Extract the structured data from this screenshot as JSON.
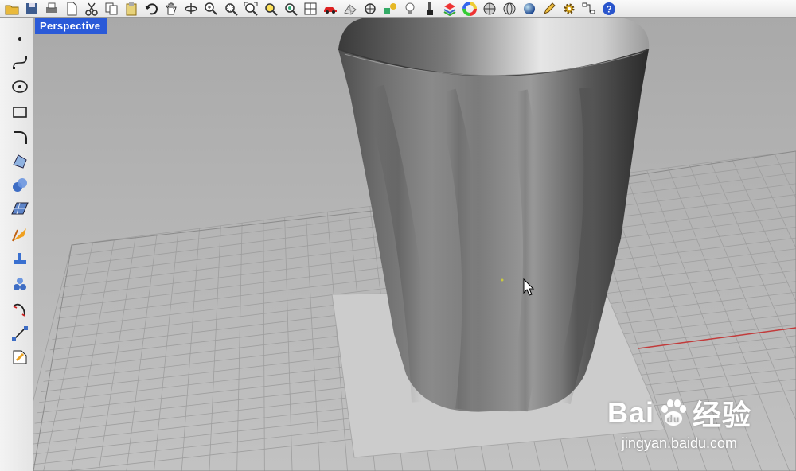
{
  "viewport": {
    "label": "Perspective"
  },
  "toolbar": {
    "icons": [
      "open-file-icon",
      "save-icon",
      "print-icon",
      "new-file-icon",
      "cut-icon",
      "copy-icon",
      "paste-icon",
      "undo-icon",
      "pan-hand-icon",
      "rotate-view-icon",
      "zoom-dynamic-icon",
      "zoom-window-icon",
      "zoom-extents-icon",
      "zoom-selected-icon",
      "zoom-target-icon",
      "four-viewports-icon",
      "car-render-icon",
      "grid-snap-icon",
      "point-on-icon",
      "object-properties-icon",
      "lightbulb-icon",
      "paintbrush-icon",
      "layers-icon",
      "color-wheel-icon",
      "shaded-sphere-icon",
      "render-sphere-icon",
      "blue-sphere-icon",
      "pencil-options-icon",
      "gear-icon",
      "history-icon",
      "help-icon"
    ]
  },
  "left_toolbar": {
    "icons": [
      "point-icon",
      "curve-icon",
      "circle-icon",
      "rectangle-icon",
      "fillet-curve-icon",
      "surface-icon",
      "solid-spheres-icon",
      "mesh-plane-icon",
      "transform-icon",
      "boolean-icon",
      "group-spheres-icon",
      "curve-from-object-icon",
      "dimension-icon",
      "analyze-icon"
    ]
  },
  "watermark": {
    "logo": "Bai du 经验",
    "logo_left": "Bai",
    "logo_right": "经验",
    "url": "jingyan.baidu.com"
  },
  "colors": {
    "viewport_label_bg": "#2a5ad8",
    "x_axis": "#c23b3b",
    "background": "#b4b4b4"
  }
}
